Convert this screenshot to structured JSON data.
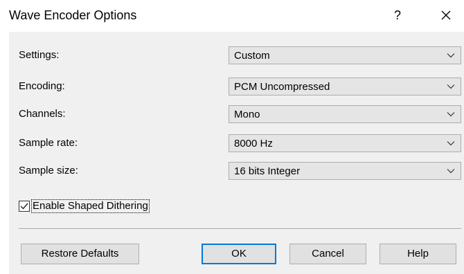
{
  "window": {
    "title": "Wave Encoder Options",
    "help_label": "?",
    "close_icon": "close-icon"
  },
  "fields": [
    {
      "label": "Settings:",
      "value": "Custom"
    },
    {
      "label": "Encoding:",
      "value": "PCM Uncompressed"
    },
    {
      "label": "Channels:",
      "value": "Mono"
    },
    {
      "label": "Sample rate:",
      "value": "8000 Hz"
    },
    {
      "label": "Sample size:",
      "value": "16 bits Integer"
    }
  ],
  "dithering": {
    "label": "Enable Shaped Dithering",
    "checked": true
  },
  "buttons": {
    "restore_defaults": "Restore Defaults",
    "ok": "OK",
    "cancel": "Cancel",
    "help": "Help"
  },
  "colors": {
    "dialog_background": "#f0f0f0",
    "dropdown_background": "#e5e5e5",
    "button_background": "#e1e1e1",
    "default_button_border": "#0078d7"
  }
}
